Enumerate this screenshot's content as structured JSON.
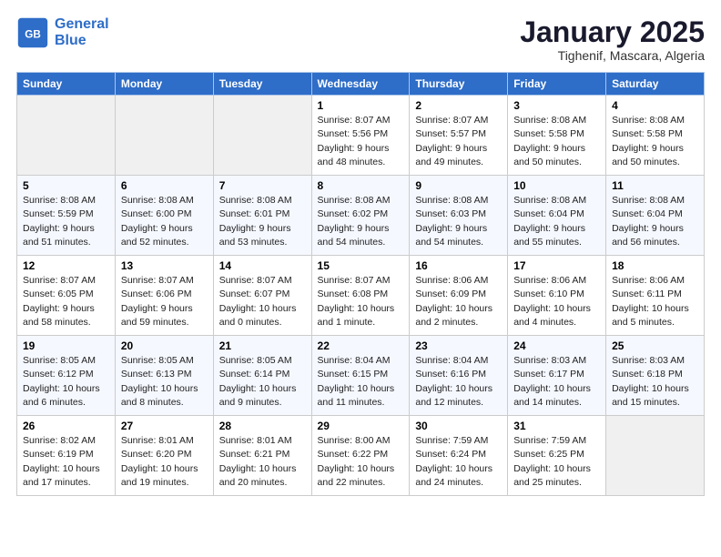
{
  "header": {
    "logo_line1": "General",
    "logo_line2": "Blue",
    "title": "January 2025",
    "subtitle": "Tighenif, Mascara, Algeria"
  },
  "weekdays": [
    "Sunday",
    "Monday",
    "Tuesday",
    "Wednesday",
    "Thursday",
    "Friday",
    "Saturday"
  ],
  "weeks": [
    [
      {
        "num": "",
        "info": ""
      },
      {
        "num": "",
        "info": ""
      },
      {
        "num": "",
        "info": ""
      },
      {
        "num": "1",
        "info": "Sunrise: 8:07 AM\nSunset: 5:56 PM\nDaylight: 9 hours\nand 48 minutes."
      },
      {
        "num": "2",
        "info": "Sunrise: 8:07 AM\nSunset: 5:57 PM\nDaylight: 9 hours\nand 49 minutes."
      },
      {
        "num": "3",
        "info": "Sunrise: 8:08 AM\nSunset: 5:58 PM\nDaylight: 9 hours\nand 50 minutes."
      },
      {
        "num": "4",
        "info": "Sunrise: 8:08 AM\nSunset: 5:58 PM\nDaylight: 9 hours\nand 50 minutes."
      }
    ],
    [
      {
        "num": "5",
        "info": "Sunrise: 8:08 AM\nSunset: 5:59 PM\nDaylight: 9 hours\nand 51 minutes."
      },
      {
        "num": "6",
        "info": "Sunrise: 8:08 AM\nSunset: 6:00 PM\nDaylight: 9 hours\nand 52 minutes."
      },
      {
        "num": "7",
        "info": "Sunrise: 8:08 AM\nSunset: 6:01 PM\nDaylight: 9 hours\nand 53 minutes."
      },
      {
        "num": "8",
        "info": "Sunrise: 8:08 AM\nSunset: 6:02 PM\nDaylight: 9 hours\nand 54 minutes."
      },
      {
        "num": "9",
        "info": "Sunrise: 8:08 AM\nSunset: 6:03 PM\nDaylight: 9 hours\nand 54 minutes."
      },
      {
        "num": "10",
        "info": "Sunrise: 8:08 AM\nSunset: 6:04 PM\nDaylight: 9 hours\nand 55 minutes."
      },
      {
        "num": "11",
        "info": "Sunrise: 8:08 AM\nSunset: 6:04 PM\nDaylight: 9 hours\nand 56 minutes."
      }
    ],
    [
      {
        "num": "12",
        "info": "Sunrise: 8:07 AM\nSunset: 6:05 PM\nDaylight: 9 hours\nand 58 minutes."
      },
      {
        "num": "13",
        "info": "Sunrise: 8:07 AM\nSunset: 6:06 PM\nDaylight: 9 hours\nand 59 minutes."
      },
      {
        "num": "14",
        "info": "Sunrise: 8:07 AM\nSunset: 6:07 PM\nDaylight: 10 hours\nand 0 minutes."
      },
      {
        "num": "15",
        "info": "Sunrise: 8:07 AM\nSunset: 6:08 PM\nDaylight: 10 hours\nand 1 minute."
      },
      {
        "num": "16",
        "info": "Sunrise: 8:06 AM\nSunset: 6:09 PM\nDaylight: 10 hours\nand 2 minutes."
      },
      {
        "num": "17",
        "info": "Sunrise: 8:06 AM\nSunset: 6:10 PM\nDaylight: 10 hours\nand 4 minutes."
      },
      {
        "num": "18",
        "info": "Sunrise: 8:06 AM\nSunset: 6:11 PM\nDaylight: 10 hours\nand 5 minutes."
      }
    ],
    [
      {
        "num": "19",
        "info": "Sunrise: 8:05 AM\nSunset: 6:12 PM\nDaylight: 10 hours\nand 6 minutes."
      },
      {
        "num": "20",
        "info": "Sunrise: 8:05 AM\nSunset: 6:13 PM\nDaylight: 10 hours\nand 8 minutes."
      },
      {
        "num": "21",
        "info": "Sunrise: 8:05 AM\nSunset: 6:14 PM\nDaylight: 10 hours\nand 9 minutes."
      },
      {
        "num": "22",
        "info": "Sunrise: 8:04 AM\nSunset: 6:15 PM\nDaylight: 10 hours\nand 11 minutes."
      },
      {
        "num": "23",
        "info": "Sunrise: 8:04 AM\nSunset: 6:16 PM\nDaylight: 10 hours\nand 12 minutes."
      },
      {
        "num": "24",
        "info": "Sunrise: 8:03 AM\nSunset: 6:17 PM\nDaylight: 10 hours\nand 14 minutes."
      },
      {
        "num": "25",
        "info": "Sunrise: 8:03 AM\nSunset: 6:18 PM\nDaylight: 10 hours\nand 15 minutes."
      }
    ],
    [
      {
        "num": "26",
        "info": "Sunrise: 8:02 AM\nSunset: 6:19 PM\nDaylight: 10 hours\nand 17 minutes."
      },
      {
        "num": "27",
        "info": "Sunrise: 8:01 AM\nSunset: 6:20 PM\nDaylight: 10 hours\nand 19 minutes."
      },
      {
        "num": "28",
        "info": "Sunrise: 8:01 AM\nSunset: 6:21 PM\nDaylight: 10 hours\nand 20 minutes."
      },
      {
        "num": "29",
        "info": "Sunrise: 8:00 AM\nSunset: 6:22 PM\nDaylight: 10 hours\nand 22 minutes."
      },
      {
        "num": "30",
        "info": "Sunrise: 7:59 AM\nSunset: 6:24 PM\nDaylight: 10 hours\nand 24 minutes."
      },
      {
        "num": "31",
        "info": "Sunrise: 7:59 AM\nSunset: 6:25 PM\nDaylight: 10 hours\nand 25 minutes."
      },
      {
        "num": "",
        "info": ""
      }
    ]
  ]
}
